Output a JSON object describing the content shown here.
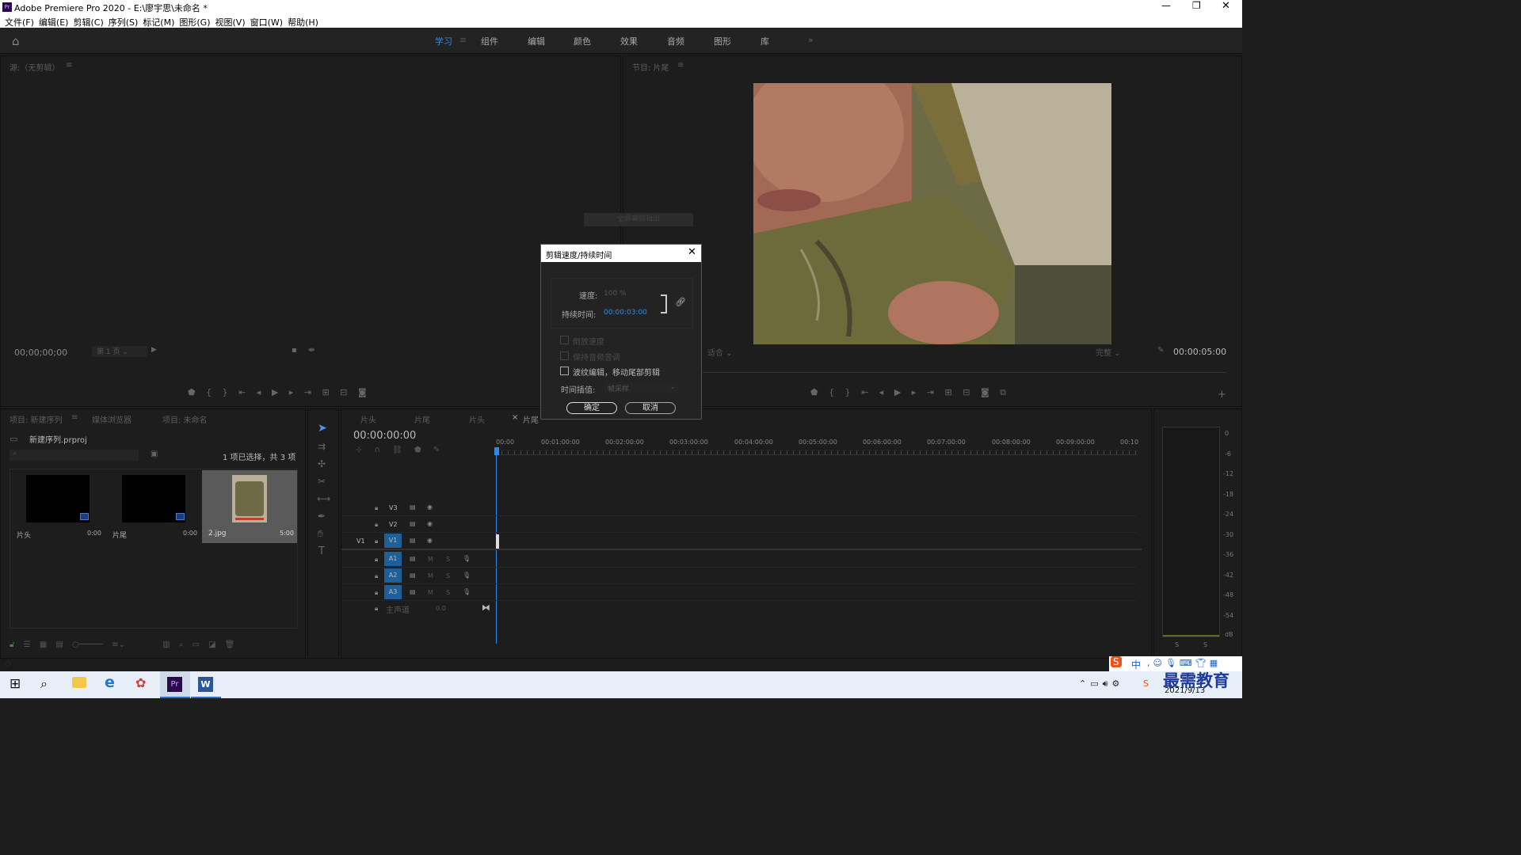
{
  "app": {
    "title": "Adobe Premiere Pro 2020 - E:\\廖宇思\\未命名 *"
  },
  "menu": [
    "文件(F)",
    "编辑(E)",
    "剪辑(C)",
    "序列(S)",
    "标记(M)",
    "图形(G)",
    "视图(V)",
    "窗口(W)",
    "帮助(H)"
  ],
  "workspaces": [
    "学习",
    "组件",
    "编辑",
    "颜色",
    "效果",
    "音频",
    "图形",
    "库"
  ],
  "workspace_active": "学习",
  "source": {
    "title": "源:（无剪辑）",
    "timecode": "00;00;00;00",
    "page": "第 1 页"
  },
  "program": {
    "title": "节目: 片尾",
    "timecode": "00:00:05:00",
    "fit": "适合",
    "quality": "完整"
  },
  "hidden_label": "全屏幕剪辑出",
  "dialog": {
    "title": "剪辑速度/持续时间",
    "speed_label": "速度:",
    "speed_value": "100 %",
    "duration_label": "持续时间:",
    "duration_value": "00:00:03:00",
    "reverse": "倒放速度",
    "keep_pitch": "保持音频音调",
    "ripple": "波纹编辑，移动尾部剪辑",
    "interp_label": "时间插值:",
    "interp_value": "帧采样",
    "ok": "确定",
    "cancel": "取消"
  },
  "project": {
    "tabs": [
      "项目: 新建序列",
      "媒体浏览器",
      "项目: 未命名"
    ],
    "file": "新建序列.prproj",
    "selection": "1 项已选择，共 3 项",
    "items": [
      {
        "name": "片头",
        "dur": "0:00"
      },
      {
        "name": "片尾",
        "dur": "0:00"
      },
      {
        "name": "2.jpg",
        "dur": "5:00"
      }
    ]
  },
  "timeline": {
    "tabs": [
      "片头",
      "片尾",
      "片头",
      "片尾"
    ],
    "timecode": "00:00:00:00",
    "ruler": [
      "00:00",
      "00:01:00:00",
      "00:02:00:00",
      "00:03:00:00",
      "00:04:00:00",
      "00:05:00:00",
      "00:06:00:00",
      "00:07:00:00",
      "00:08:00:00",
      "00:09:00:00",
      "00:10"
    ],
    "video_tracks": [
      "V3",
      "V2",
      "V1"
    ],
    "audio_tracks": [
      "A1",
      "A2",
      "A3"
    ],
    "v1_source": "V1",
    "master": "主声道",
    "master_val": "0.0",
    "m": "M",
    "s": "S"
  },
  "meter": {
    "labels": [
      "0",
      "-6",
      "-12",
      "-18",
      "-24",
      "-30",
      "-36",
      "-42",
      "-48",
      "-54",
      "dB"
    ],
    "s_labels": [
      "S",
      "S"
    ]
  },
  "taskbar": {
    "date": "2021/9/13",
    "ime": "中",
    "watermark": "最需教育"
  },
  "colors": {
    "accent": "#2d8ceb",
    "track_blue": "#1f5f9a"
  }
}
